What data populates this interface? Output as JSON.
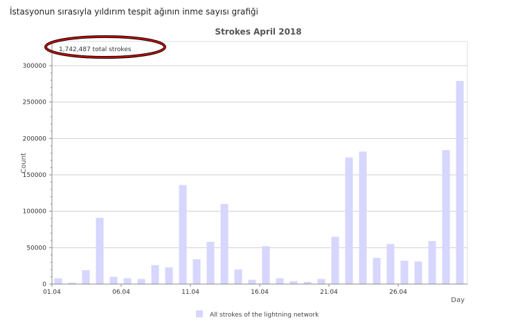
{
  "page": {
    "heading": "İstasyonun sırasıyla yıldırım tespit ağının inme sayısı grafiği"
  },
  "colors": {
    "bar": "#d6d6ff",
    "grid": "#cfcfcf",
    "axis": "#888888",
    "highlight": "#cc0000"
  },
  "chart_data": {
    "type": "bar",
    "title": "Strokes April 2018",
    "total_label": "1,742,487 total strokes",
    "xlabel": "Day",
    "ylabel": "Count",
    "ylim": [
      0,
      300000
    ],
    "yticks": [
      0,
      50000,
      100000,
      150000,
      200000,
      250000,
      300000
    ],
    "ytick_labels": [
      "0",
      "50000",
      "100000",
      "150000",
      "200000",
      "250000",
      "300000"
    ],
    "xtick_days": [
      1,
      6,
      11,
      16,
      21,
      26
    ],
    "xtick_labels": [
      "01.04",
      "06.04",
      "11.04",
      "16.04",
      "21.04",
      "26.04"
    ],
    "grid": true,
    "legend_position": "bottom",
    "series": [
      {
        "name": "All strokes of the lightning network",
        "days": [
          1,
          2,
          3,
          4,
          5,
          6,
          7,
          8,
          9,
          10,
          11,
          12,
          13,
          14,
          15,
          16,
          17,
          18,
          19,
          20,
          21,
          22,
          23,
          24,
          25,
          26,
          27,
          28,
          29,
          30
        ],
        "values": [
          8000,
          2000,
          19000,
          91000,
          10000,
          8000,
          7000,
          26000,
          23000,
          136000,
          34000,
          58000,
          110000,
          20000,
          6000,
          52000,
          8000,
          4000,
          3000,
          7000,
          65000,
          174000,
          182000,
          36000,
          55000,
          32000,
          31000,
          59000,
          184000,
          279000
        ]
      }
    ]
  }
}
